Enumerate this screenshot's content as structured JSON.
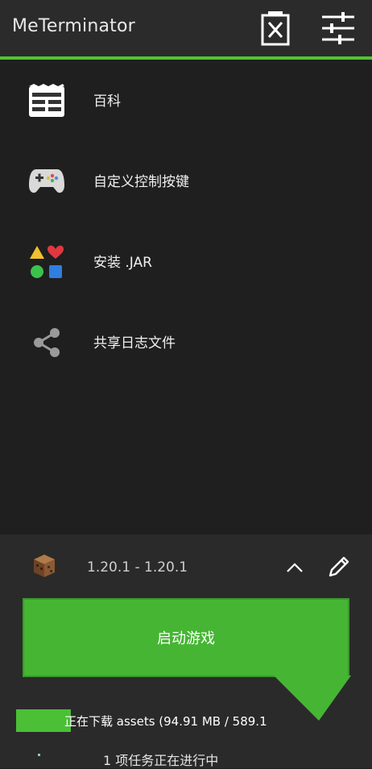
{
  "app": {
    "title": "MeTerminator"
  },
  "header": {
    "delete_icon": "delete-x-icon",
    "settings_icon": "sliders-settings-icon"
  },
  "colors": {
    "accent": "#52c234",
    "play_button": "#46b534",
    "background": "#1f1f1f"
  },
  "menu": [
    {
      "label": "百科",
      "icon": "wiki-newspaper-icon"
    },
    {
      "label": "自定义控制按键",
      "icon": "gamepad-icon"
    },
    {
      "label": "安装 .JAR",
      "icon": "install-shapes-icon"
    },
    {
      "label": "共享日志文件",
      "icon": "share-icon"
    }
  ],
  "version": {
    "label": "1.20.1 - 1.20.1",
    "icon": "crafting-block-icon"
  },
  "play_button": {
    "label": "启动游戏"
  },
  "progress": {
    "text": "正在下载 assets (94.91 MB / 589.1",
    "fraction": 0.16
  },
  "tasks": {
    "text": "1 项任务正在进行中"
  }
}
